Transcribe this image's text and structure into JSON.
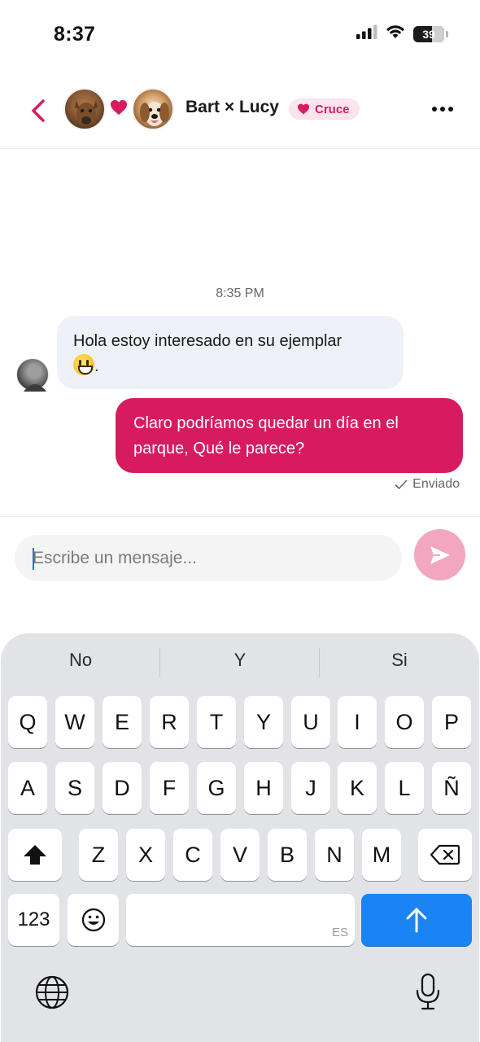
{
  "status_bar": {
    "time": "8:37",
    "battery": "39",
    "battery_level": 0.39
  },
  "header": {
    "title": "Bart × Lucy",
    "badge": "Cruce",
    "accent_color": "#d81b60"
  },
  "chat": {
    "timestamp": "8:35 PM",
    "messages": [
      {
        "direction": "incoming",
        "text": "Hola estoy interesado en su ejemplar",
        "suffix": "."
      },
      {
        "direction": "outgoing",
        "text": "Claro podríamos quedar un día en el parque, Qué le parece?"
      }
    ],
    "sent_status": "Enviado"
  },
  "composer": {
    "placeholder": "Escribe un mensaje...",
    "value": ""
  },
  "keyboard": {
    "suggestions": [
      "No",
      "Y",
      "Si"
    ],
    "row1": [
      "Q",
      "W",
      "E",
      "R",
      "T",
      "Y",
      "U",
      "I",
      "O",
      "P"
    ],
    "row2": [
      "A",
      "S",
      "D",
      "F",
      "G",
      "H",
      "J",
      "K",
      "L",
      "Ñ"
    ],
    "row3": [
      "Z",
      "X",
      "C",
      "V",
      "B",
      "N",
      "M"
    ],
    "numbers_label": "123",
    "language_label": "ES"
  },
  "icons": {
    "back": "chevron-left-icon",
    "heart": "heart-icon",
    "more": "more-horizontal-icon",
    "send": "send-icon",
    "shift": "shift-icon",
    "delete": "backspace-icon",
    "emoji": "emoji-icon",
    "return": "arrow-up-icon",
    "globe": "globe-icon",
    "mic": "microphone-icon",
    "check": "check-icon"
  }
}
